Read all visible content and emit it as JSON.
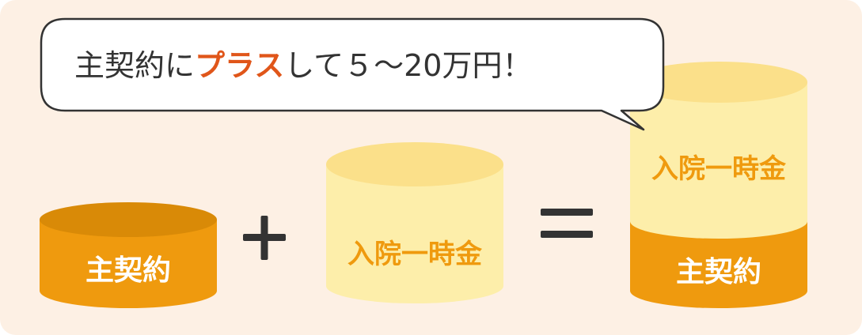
{
  "bubble": {
    "text_before": "主契約に",
    "text_accent": "プラス",
    "text_after": "して５～20万円！"
  },
  "left_cylinder": {
    "label": "主契約"
  },
  "plus_symbol": "+",
  "middle_cylinder": {
    "label": "入院一時金"
  },
  "equals_symbol": "=",
  "right_stack": {
    "top_label": "入院一時金",
    "bottom_label": "主契約"
  },
  "colors": {
    "background": "#fdf0e4",
    "main_contract": "#ef9a0e",
    "main_contract_top": "#d98a07",
    "hospital_lump_sum": "#fdeeaa",
    "hospital_lump_sum_top": "#fbe08a",
    "accent_text": "#e0561a",
    "dark_text": "#333333"
  }
}
